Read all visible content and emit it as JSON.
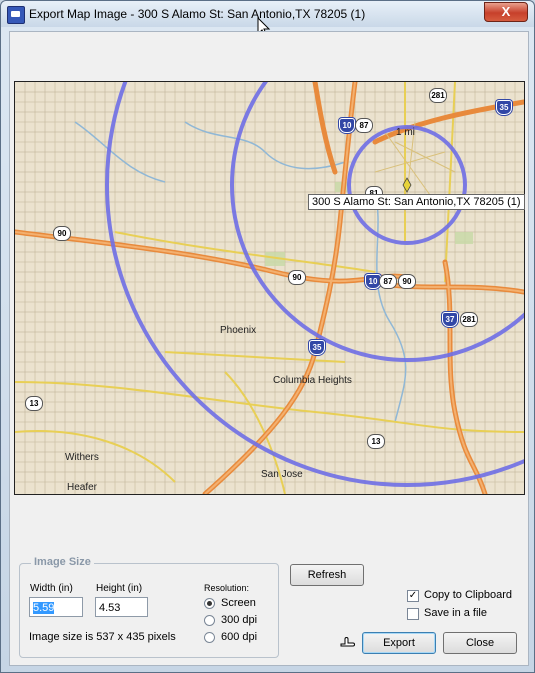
{
  "window": {
    "title": "Export Map Image - 300 S Alamo St: San Antonio,TX 78205 (1)",
    "close_glyph": "X",
    "accent": "#3558b8"
  },
  "map": {
    "tooltip": "300 S Alamo St: San Antonio,TX 78205 (1)",
    "scale_label": "1 mi",
    "place_labels": [
      "Phoenix",
      "Columbia Heights",
      "Withers",
      "Heafer",
      "San Jose"
    ],
    "interstate_shields": [
      "10",
      "35",
      "10",
      "35",
      "37"
    ],
    "state_shields": [
      "87",
      "281",
      "81",
      "90",
      "90",
      "87",
      "90",
      "281",
      "13",
      "13"
    ],
    "ring_color": "#6f6fe6"
  },
  "image_size": {
    "group_title": "Image Size",
    "width_label": "Width (in)",
    "width_value": "5.59",
    "height_label": "Height (in)",
    "height_value": "4.53",
    "pixels_text": "Image size is 537 x 435 pixels"
  },
  "resolution": {
    "label": "Resolution:",
    "options": [
      "Screen",
      "300 dpi",
      "600 dpi"
    ],
    "selected": "Screen"
  },
  "buttons": {
    "refresh": "Refresh",
    "export": "Export",
    "close": "Close"
  },
  "options": {
    "copy_clipboard": "Copy to Clipboard",
    "copy_clipboard_checked": true,
    "save_file": "Save in a file",
    "save_file_checked": false
  }
}
